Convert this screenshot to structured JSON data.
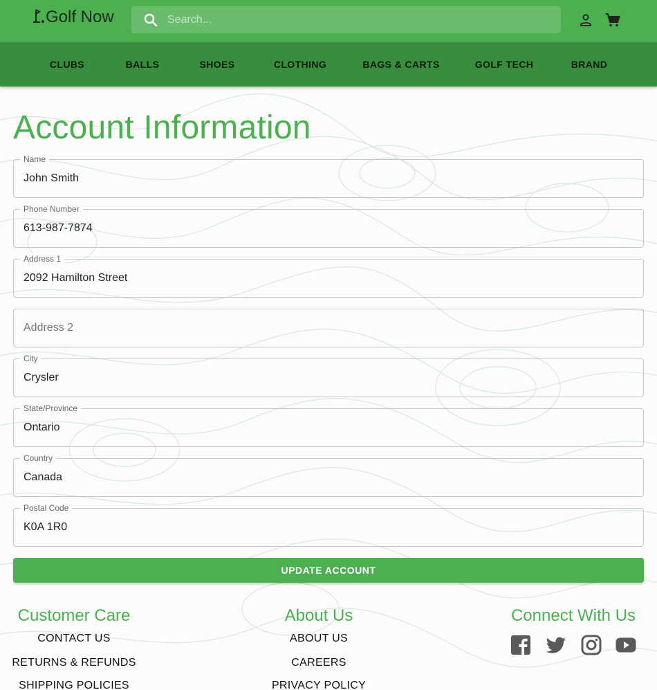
{
  "header": {
    "brand": "Golf Now",
    "search_placeholder": "Search...",
    "nav": [
      "CLUBS",
      "BALLS",
      "SHOES",
      "CLOTHING",
      "BAGS & CARTS",
      "GOLF TECH",
      "BRAND"
    ]
  },
  "main": {
    "title": "Account Information",
    "fields": {
      "name": {
        "label": "Name",
        "value": "John Smith"
      },
      "phone": {
        "label": "Phone Number",
        "value": "613-987-7874"
      },
      "address1": {
        "label": "Address 1",
        "value": "2092 Hamilton Street"
      },
      "address2": {
        "placeholder": "Address 2"
      },
      "city": {
        "label": "City",
        "value": "Crysler"
      },
      "state": {
        "label": "State/Province",
        "value": "Ontario"
      },
      "country": {
        "label": "Country",
        "value": "Canada"
      },
      "postal": {
        "label": "Postal Code",
        "value": "K0A 1R0"
      }
    },
    "update_label": "UPDATE ACCOUNT"
  },
  "footer": {
    "customer_care": {
      "title": "Customer Care",
      "links": [
        "CONTACT US",
        "RETURNS & REFUNDS",
        "SHIPPING POLICIES"
      ]
    },
    "about": {
      "title": "About Us",
      "links": [
        "ABOUT US",
        "CAREERS",
        "PRIVACY POLICY"
      ]
    },
    "connect": {
      "title": "Connect With Us",
      "icons": [
        "facebook-icon",
        "twitter-icon",
        "instagram-icon",
        "youtube-icon"
      ]
    }
  },
  "colors": {
    "primary": "#4caf50",
    "nav_bg": "#388e3c",
    "search_bg": "#6abc6d"
  }
}
